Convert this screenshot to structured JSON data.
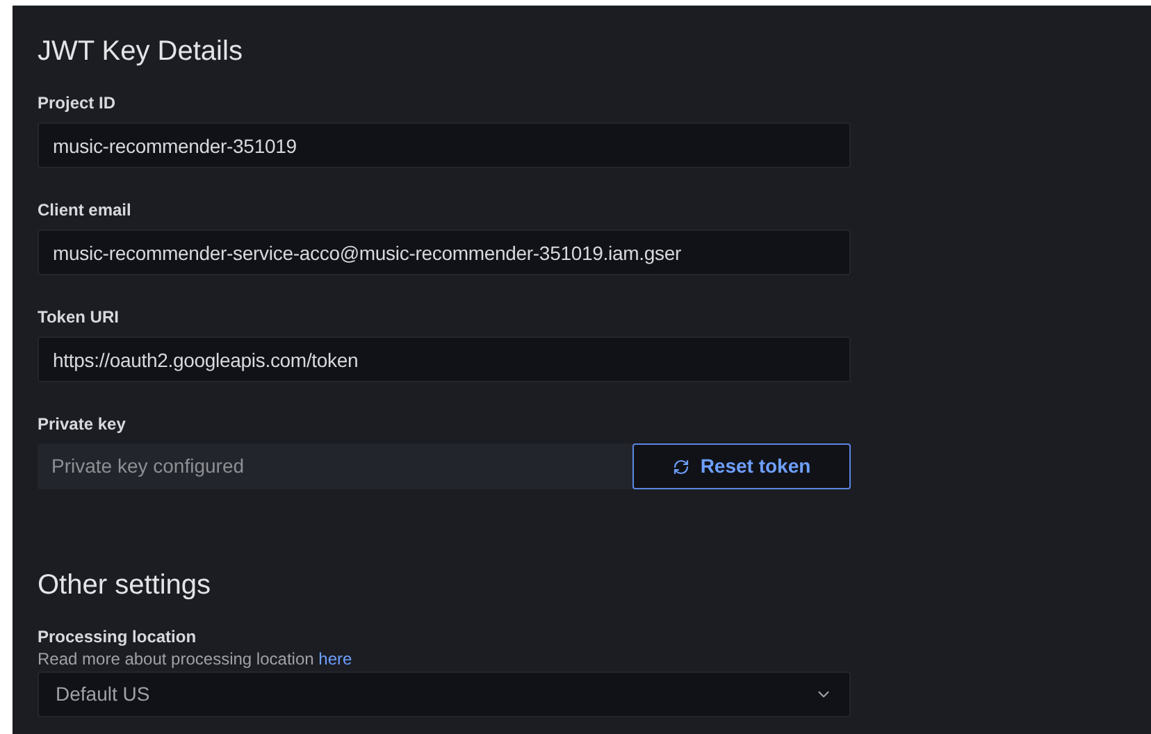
{
  "jwt_section": {
    "title": "JWT Key Details",
    "fields": [
      {
        "kind": "text",
        "label": "Project ID",
        "value": "music-recommender-351019"
      },
      {
        "kind": "text",
        "label": "Client email",
        "value": "music-recommender-service-acco@music-recommender-351019.iam.gser"
      },
      {
        "kind": "text",
        "label": "Token URI",
        "value": "https://oauth2.googleapis.com/token"
      },
      {
        "kind": "secret",
        "label": "Private key",
        "placeholder": "Private key configured",
        "button": "Reset token"
      }
    ]
  },
  "other_section": {
    "title": "Other settings",
    "processing_location": {
      "label": "Processing location",
      "description": "Read more about processing location",
      "link": "here",
      "value": "Default US"
    }
  }
}
